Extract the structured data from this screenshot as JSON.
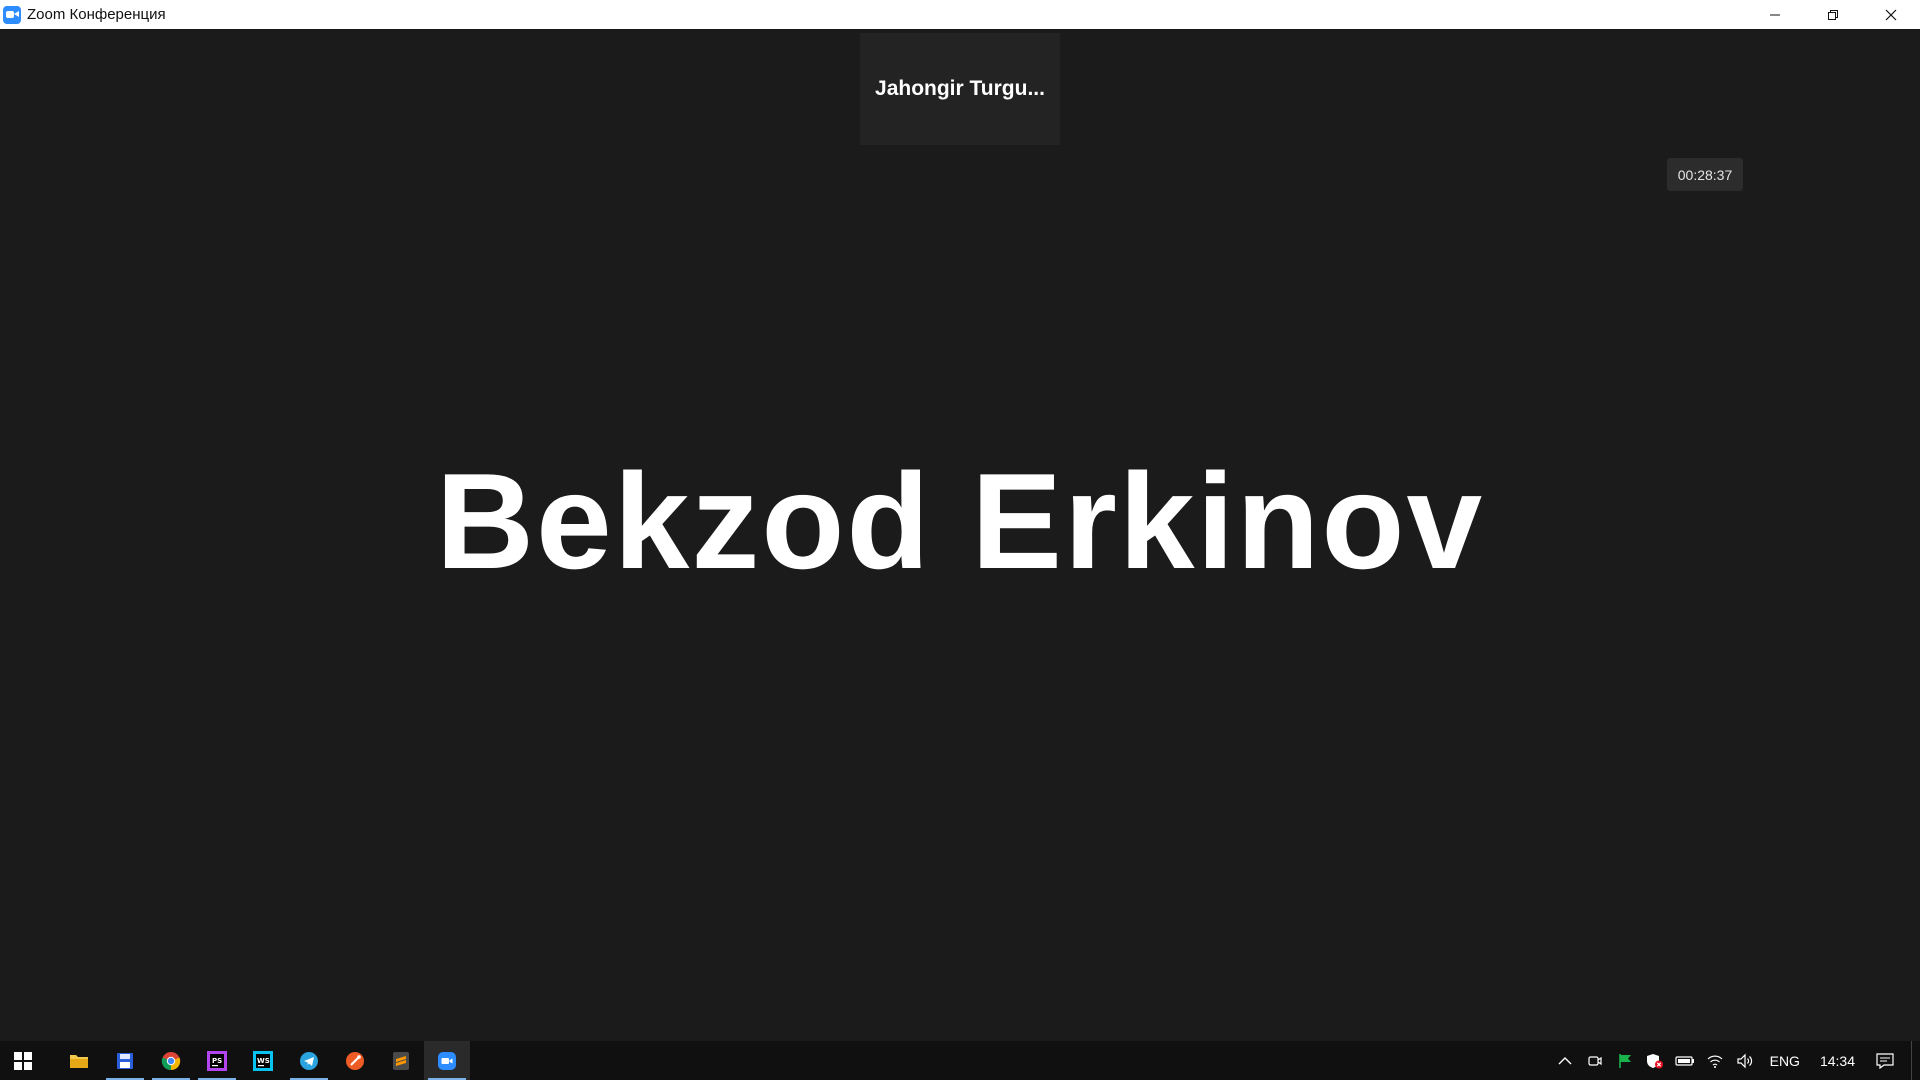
{
  "window": {
    "title": "Zoom Конференция"
  },
  "meeting": {
    "thumbnail_name": "Jahongir Turgu...",
    "timer": "00:28:37",
    "active_speaker": "Bekzod Erkinov"
  },
  "taskbar": {
    "apps": [
      {
        "name": "start",
        "icon": "windows-icon"
      },
      {
        "name": "file-explorer",
        "icon": "folder-icon"
      },
      {
        "name": "save-app",
        "icon": "floppy-icon"
      },
      {
        "name": "chrome",
        "icon": "chrome-icon"
      },
      {
        "name": "phpstorm",
        "icon": "phpstorm-icon"
      },
      {
        "name": "webstorm",
        "icon": "webstorm-icon"
      },
      {
        "name": "telegram",
        "icon": "telegram-icon"
      },
      {
        "name": "postman",
        "icon": "postman-icon"
      },
      {
        "name": "sublime-text",
        "icon": "sublime-icon"
      },
      {
        "name": "zoom",
        "icon": "zoom-icon"
      }
    ],
    "language": "ENG",
    "clock": "14:34"
  },
  "colors": {
    "background": "#1b1b1b",
    "zoom_blue": "#2d8cff",
    "taskbar": "#101010"
  }
}
